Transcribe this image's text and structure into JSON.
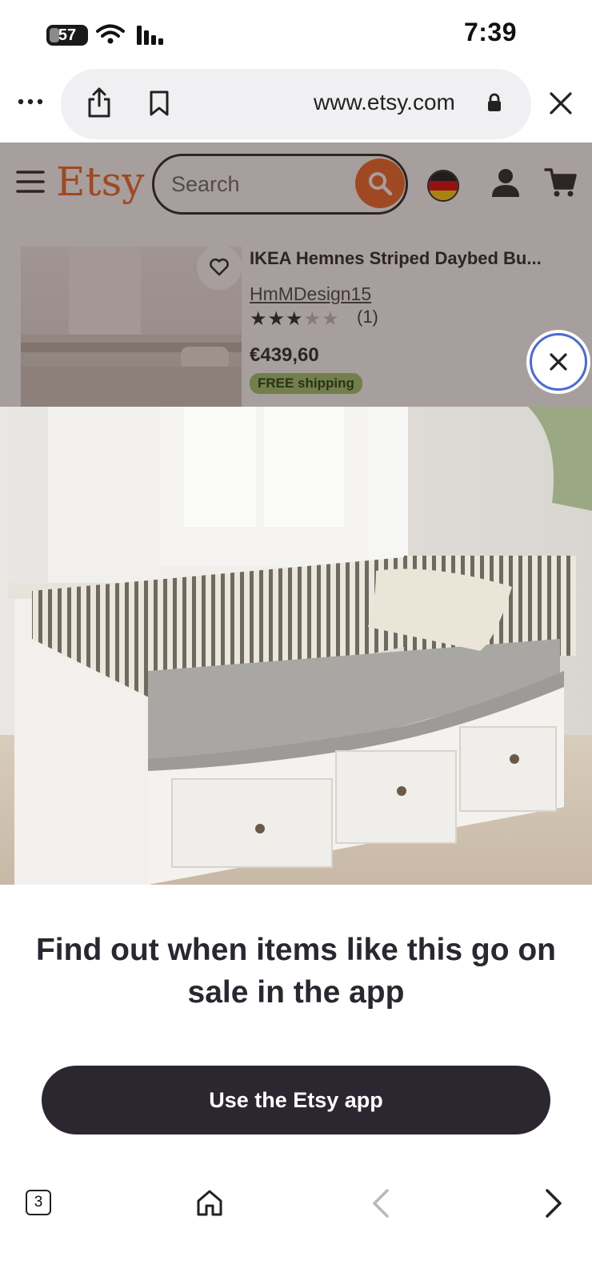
{
  "status_bar": {
    "battery": "57",
    "time": "7:39"
  },
  "browser": {
    "url": "www.etsy.com"
  },
  "etsy_header": {
    "logo": "Etsy",
    "search_placeholder": "Search"
  },
  "listing": {
    "title": "IKEA Hemnes Striped Daybed Bu...",
    "seller": "HmMDesign15",
    "rating": 3,
    "rating_max": 5,
    "review_count": "(1)",
    "price": "€439,60",
    "shipping_badge": "FREE shipping"
  },
  "sheet": {
    "headline": "Find out when items like this go on sale in the app",
    "cta_label": "Use the Etsy app"
  },
  "bottom_bar": {
    "tab_count": "3"
  },
  "colors": {
    "etsy_orange": "#f1641e",
    "cta_bg": "#2b2630",
    "shipping_badge": "#9ec76b",
    "close_ring": "#4a6ad6"
  }
}
